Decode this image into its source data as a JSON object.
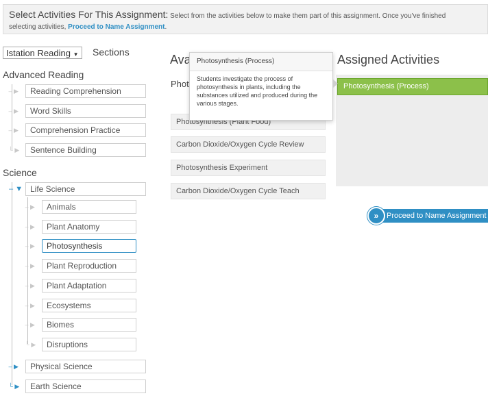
{
  "header": {
    "title": "Select Activities For This Assignment",
    "colon": ":",
    "description": " Select from the activities below to make them part of this assignment. Once you've finished",
    "line2_prefix": "selecting activities, ",
    "line2_link": "Proceed to Name Assignment",
    "line2_suffix": "."
  },
  "program": {
    "selected": "Istation Reading",
    "sections_label": "Sections"
  },
  "groups": [
    {
      "title": "Advanced Reading",
      "items": [
        "Reading Comprehension",
        "Word Skills",
        "Comprehension Practice",
        "Sentence Building"
      ]
    },
    {
      "title": "Science",
      "life_science": "Life Science",
      "life_children": [
        "Animals",
        "Plant Anatomy",
        "Photosynthesis",
        "Plant Reproduction",
        "Plant Adaptation",
        "Ecosystems",
        "Biomes",
        "Disruptions"
      ],
      "physical_science": "Physical Science",
      "earth_science": "Earth Science"
    }
  ],
  "available": {
    "title_visible": "Ava",
    "partial_label": "Phot",
    "activities": [
      "Photosynthesis (Plant Food)",
      "Carbon Dioxide/Oxygen Cycle Review",
      "Photosynthesis Experiment",
      "Carbon Dioxide/Oxygen Cycle Teach"
    ]
  },
  "tooltip": {
    "title": "Photosynthesis (Process)",
    "body": "Students investigate the process of photosynthesis in plants, including the substances utilized and produced during the various stages."
  },
  "assigned": {
    "title": "Assigned Activities",
    "items": [
      "Photosynthesis (Process)"
    ]
  },
  "proceed_button": {
    "label": "Proceed to Name Assignment",
    "icon": "double-chevron-right-icon"
  },
  "colors": {
    "accent": "#2f8fc4",
    "assigned_green": "#8cc04a"
  }
}
